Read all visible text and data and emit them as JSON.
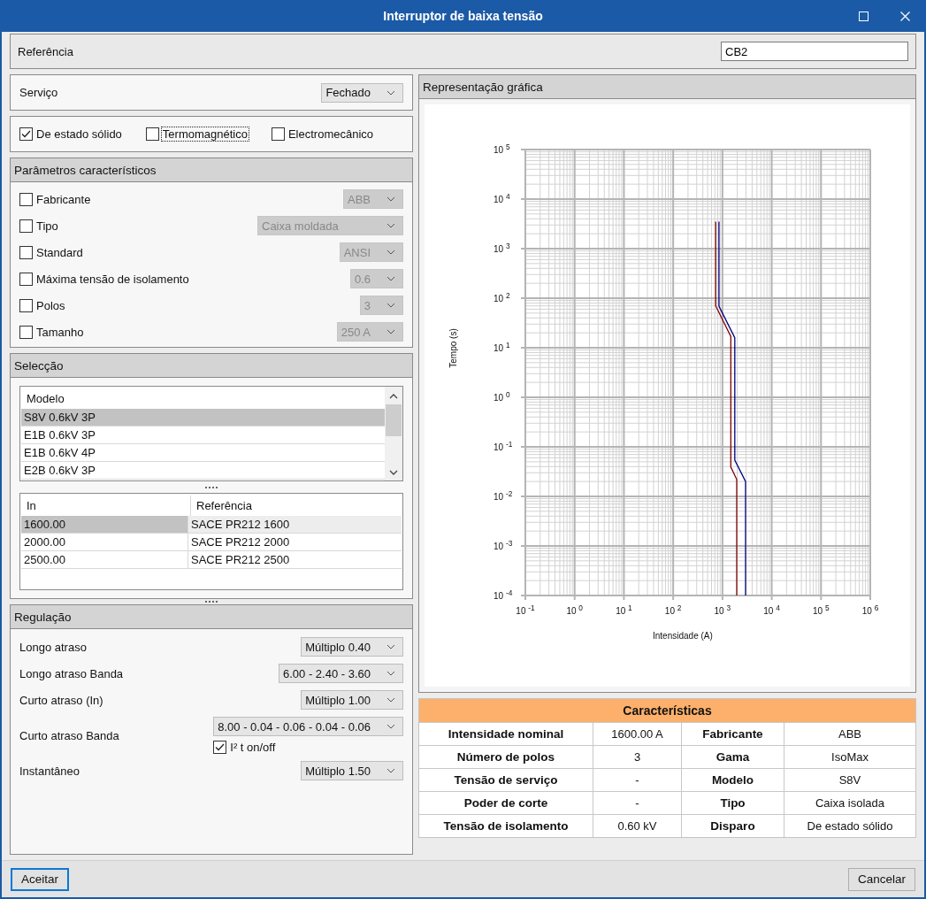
{
  "window": {
    "title": "Interruptor de baixa tensão"
  },
  "reference": {
    "label": "Referência",
    "value": "CB2"
  },
  "service": {
    "label": "Serviço",
    "value": "Fechado"
  },
  "trip_types": [
    {
      "label": "De estado sólido",
      "checked": true,
      "focused": false
    },
    {
      "label": "Termomagnético",
      "checked": false,
      "focused": true
    },
    {
      "label": "Electromecânico",
      "checked": false,
      "focused": false
    }
  ],
  "parameters": {
    "title": "Parâmetros característicos",
    "items": [
      {
        "label": "Fabricante",
        "checked": false,
        "value": "ABB",
        "disabled": true
      },
      {
        "label": "Tipo",
        "checked": false,
        "value": "Caixa moldada",
        "disabled": true
      },
      {
        "label": "Standard",
        "checked": false,
        "value": "ANSI",
        "disabled": true
      },
      {
        "label": "Máxima tensão de isolamento",
        "checked": false,
        "value": "0.6",
        "disabled": true
      },
      {
        "label": "Polos",
        "checked": false,
        "value": "3",
        "disabled": true
      },
      {
        "label": "Tamanho",
        "checked": false,
        "value": "250 A",
        "disabled": true
      }
    ]
  },
  "selection": {
    "title": "Selecção",
    "models": {
      "header": "Modelo",
      "rows": [
        {
          "label": "S8V 0.6kV 3P",
          "selected": true
        },
        {
          "label": "E1B 0.6kV 3P",
          "selected": false
        },
        {
          "label": "E1B 0.6kV 4P",
          "selected": false
        },
        {
          "label": "E2B 0.6kV 3P",
          "selected": false
        }
      ]
    },
    "ratings": {
      "columns": [
        "In",
        "Referência"
      ],
      "rows": [
        {
          "cells": [
            "1600.00",
            "SACE PR212 1600"
          ],
          "selected": true
        },
        {
          "cells": [
            "2000.00",
            "SACE PR212 2000"
          ],
          "selected": false
        },
        {
          "cells": [
            "2500.00",
            "SACE PR212 2500"
          ],
          "selected": false
        }
      ]
    }
  },
  "regulation": {
    "title": "Regulação",
    "rows": [
      {
        "label": "Longo atraso",
        "value": "Múltiplo 0.40"
      },
      {
        "label": "Longo atraso Banda",
        "value": "6.00 - 2.40 - 3.60"
      },
      {
        "label": "Curto atraso (In)",
        "value": "Múltiplo 1.00"
      },
      {
        "label": "Curto atraso Banda",
        "value": "8.00 - 0.04 - 0.06 - 0.04 - 0.06",
        "option": {
          "label": "I² t on/off",
          "checked": true
        }
      },
      {
        "label": "Instantâneo",
        "value": "Múltiplo 1.50"
      }
    ]
  },
  "graph": {
    "title": "Representação gráfica",
    "xlabel": "Intensidade (A)",
    "ylabel": "Tempo (s)",
    "x_tick_labels": [
      "10 $^{-1}$",
      "10 $^{0}$",
      "10 $^{1}$",
      "10 $^{2}$",
      "10 $^{3}$",
      "10 $^{4}$",
      "10 $^{5}$",
      "10 $^{6}$"
    ],
    "y_tick_labels": [
      "10 $^{5}$",
      "10 $^{4}$",
      "10 $^{3}$",
      "10 $^{2}$",
      "10 $^{1}$",
      "10 $^{0}$",
      "10 $^{-1}$",
      "10 $^{-2}$",
      "10 $^{-3}$",
      "10 $^{-4}$"
    ]
  },
  "characteristics": {
    "title": "Características",
    "rows": [
      [
        "Intensidade nominal",
        "1600.00 A",
        "Fabricante",
        "ABB"
      ],
      [
        "Número de polos",
        "3",
        "Gama",
        "IsoMax"
      ],
      [
        "Tensão de serviço",
        "-",
        "Modelo",
        "S8V"
      ],
      [
        "Poder de corte",
        "-",
        "Tipo",
        "Caixa isolada"
      ],
      [
        "Tensão de isolamento",
        "0.60 kV",
        "Disparo",
        "De estado sólido"
      ]
    ]
  },
  "buttons": [
    {
      "label": "Aceitar",
      "focused": true
    },
    {
      "label": "Cancelar",
      "focused": false
    }
  ]
}
